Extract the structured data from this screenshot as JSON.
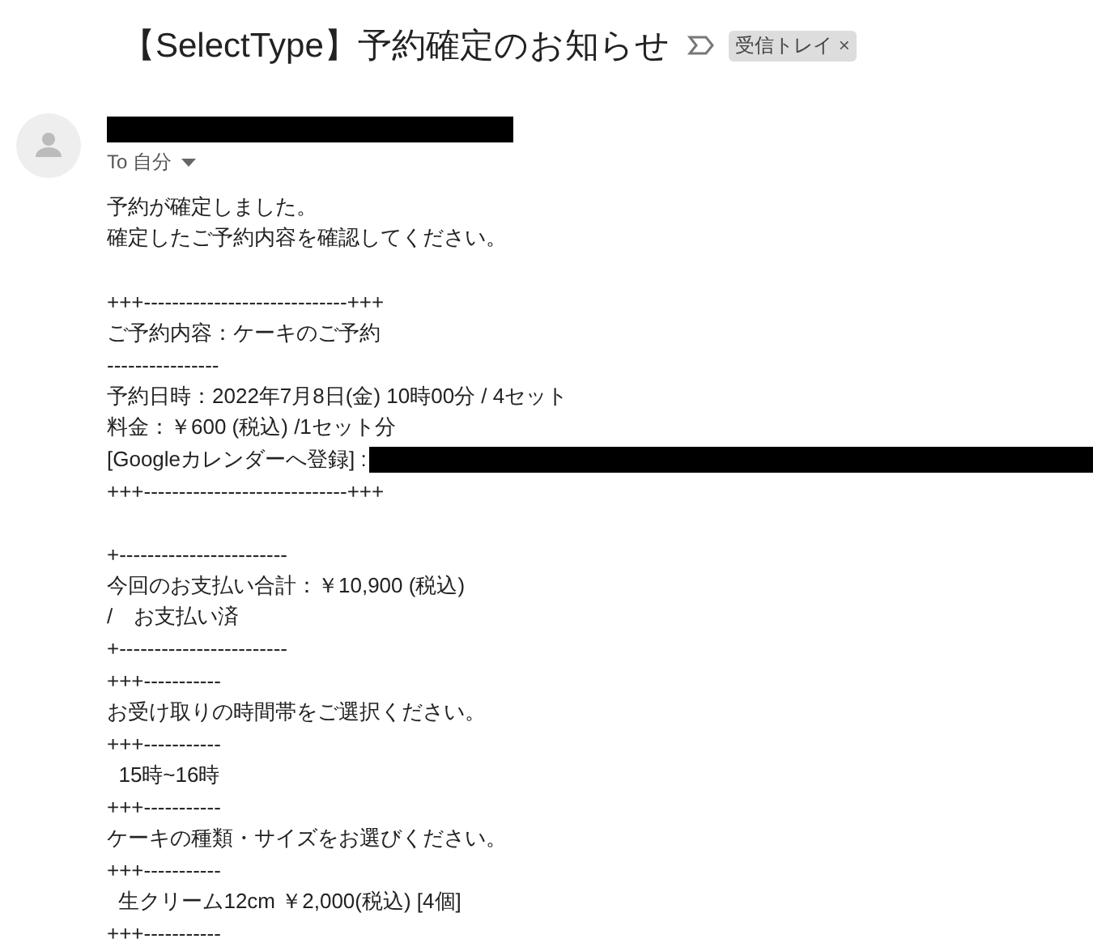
{
  "subject": {
    "title": "【SelectType】予約確定のお知らせ",
    "label": "受信トレイ",
    "label_remove": "×"
  },
  "sender": {
    "recipient": "To 自分"
  },
  "body": [
    {
      "kind": "text",
      "text": "予約が確定しました。"
    },
    {
      "kind": "text",
      "text": "確定したご予約内容を確認してください。"
    },
    {
      "kind": "blank"
    },
    {
      "kind": "text",
      "text": "+++-----------------------------+++"
    },
    {
      "kind": "text",
      "text": "ご予約内容：ケーキのご予約"
    },
    {
      "kind": "text",
      "text": "----------------"
    },
    {
      "kind": "text",
      "text": "予約日時：2022年7月8日(金) 10時00分 / 4セット"
    },
    {
      "kind": "text",
      "text": "料金：￥600 (税込) /1セット分"
    },
    {
      "kind": "redacted",
      "text": "[Googleカレンダーへ登録] :"
    },
    {
      "kind": "text",
      "text": "+++-----------------------------+++"
    },
    {
      "kind": "blank"
    },
    {
      "kind": "text",
      "text": "+------------------------"
    },
    {
      "kind": "text",
      "text": "今回のお支払い合計：￥10,900 (税込)"
    },
    {
      "kind": "text",
      "text": "/　お支払い済"
    },
    {
      "kind": "text",
      "text": "+------------------------"
    },
    {
      "kind": "text",
      "text": "+++-----------"
    },
    {
      "kind": "text",
      "text": "お受け取りの時間帯をご選択ください。"
    },
    {
      "kind": "text",
      "text": "+++-----------"
    },
    {
      "kind": "text",
      "text": "  15時~16時"
    },
    {
      "kind": "text",
      "text": "+++-----------"
    },
    {
      "kind": "text",
      "text": "ケーキの種類・サイズをお選びください。"
    },
    {
      "kind": "text",
      "text": "+++-----------"
    },
    {
      "kind": "text",
      "text": "  生クリーム12cm ￥2,000(税込) [4個]"
    },
    {
      "kind": "text",
      "text": "+++-----------"
    }
  ]
}
